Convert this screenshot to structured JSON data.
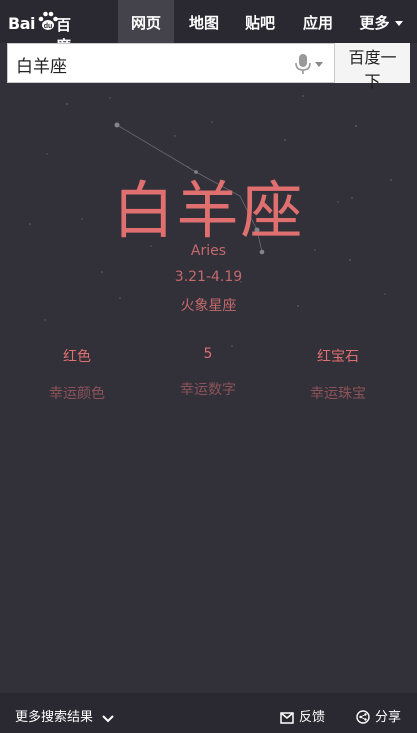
{
  "nav": {
    "logo_bai": "Bai",
    "logo_du": "百度",
    "tabs": [
      "网页",
      "地图",
      "贴吧",
      "应用"
    ],
    "more": "更多"
  },
  "search": {
    "query": "白羊座",
    "button": "百度一下"
  },
  "sign": {
    "name": "白羊座",
    "english": "Aries",
    "dates": "3.21-4.19",
    "element": "火象星座"
  },
  "lucky": {
    "color_value": "红色",
    "color_label": "幸运颜色",
    "number_value": "5",
    "number_label": "幸运数字",
    "gem_value": "红宝石",
    "gem_label": "幸运珠宝"
  },
  "footer": {
    "more_results": "更多搜索结果",
    "feedback": "反馈",
    "share": "分享"
  },
  "colors": {
    "background": "#323039",
    "accent": "#e07070",
    "muted_label": "#8c5358"
  },
  "icons": [
    "paw-logo-icon",
    "microphone-icon",
    "chevron-down-icon",
    "mail-icon",
    "share-icon"
  ]
}
